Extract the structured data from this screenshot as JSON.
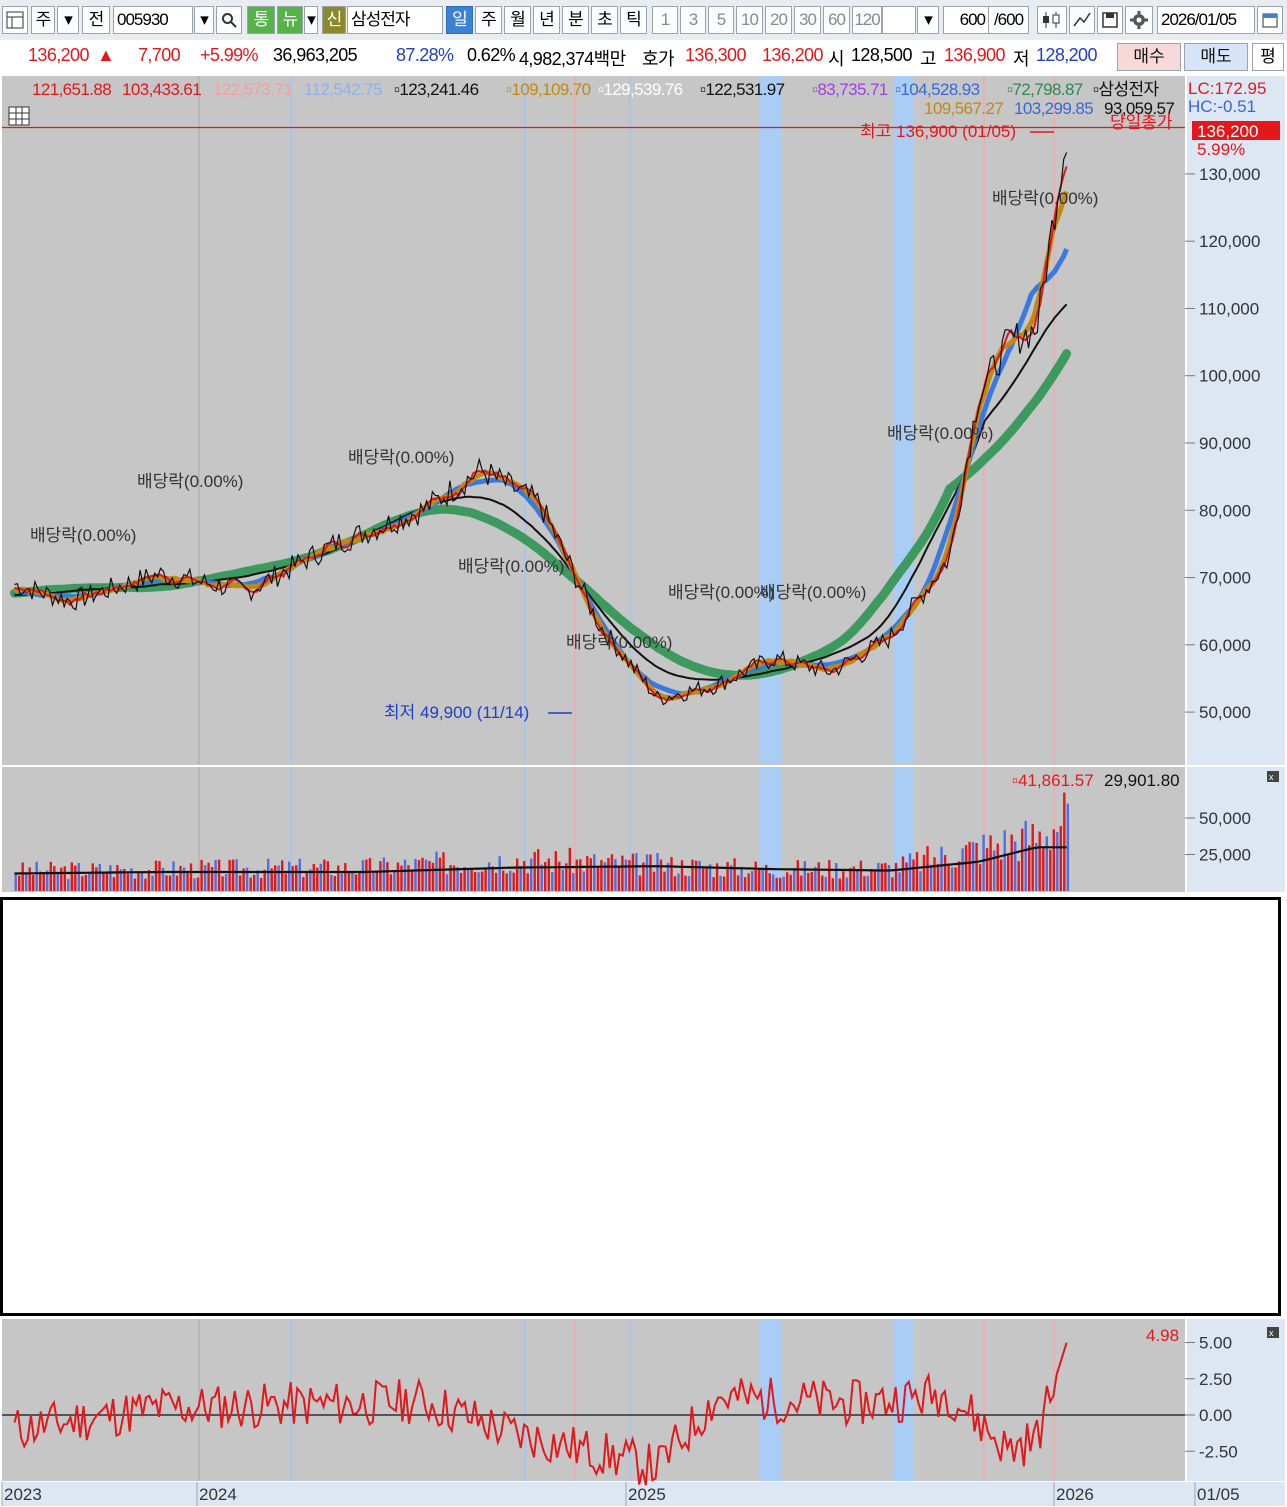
{
  "toolbar": {
    "market": "주",
    "prefix": "전",
    "code": "005930",
    "tong": "통",
    "nyu": "뉴",
    "sin": "신",
    "name": "삼성전자",
    "periods": [
      "일",
      "주",
      "월",
      "년",
      "분",
      "초",
      "틱"
    ],
    "active_period": "일",
    "intervals": [
      "1",
      "3",
      "5",
      "10",
      "20",
      "30",
      "60",
      "120"
    ],
    "count": "600",
    "count_total": "/600",
    "date": "2026/01/05"
  },
  "quote": {
    "price": "136,200",
    "arrow": "▲",
    "change": "7,700",
    "change_pct": "+5.99%",
    "volume": "36,963,205",
    "vol_ratio": "87.28%",
    "turnover": "0.62%",
    "trade_value": "4,982,374백만",
    "hoga_label": "호가",
    "ask": "136,300",
    "bid": "136,200",
    "open_label": "시",
    "open": "128,500",
    "high_label": "고",
    "high": "136,900",
    "low_label": "저",
    "low": "128,200",
    "buy_label": "매수",
    "sell_label": "매도",
    "flat_label": "평"
  },
  "legend_row1": [
    {
      "text": "121,651.88",
      "color": "#e0191d"
    },
    {
      "text": "103,433.61",
      "color": "#e0191d"
    },
    {
      "text": "122,573.71",
      "color": "#f0a0a0"
    },
    {
      "text": "112,542.75",
      "color": "#8fb2e6"
    },
    {
      "text": "▫123,241.46",
      "color": "#111111"
    },
    {
      "text": "▫109,109.70",
      "color": "#c08a10"
    },
    {
      "text": "▫129,539.76",
      "color": "#ffffff"
    },
    {
      "text": "▫122,531.97",
      "color": "#111111"
    },
    {
      "text": "▫83,735.71",
      "color": "#a040e0"
    },
    {
      "text": "▫104,528.93",
      "color": "#3a66d8"
    },
    {
      "text": "▫72,798.87",
      "color": "#2e8a52"
    },
    {
      "text": "▫삼성전자",
      "color": "#111111"
    }
  ],
  "legend_row2": [
    {
      "text": "109,567.27",
      "color": "#c08a10"
    },
    {
      "text": "103,299.85",
      "color": "#3a66d8"
    },
    {
      "text": "93,059.57",
      "color": "#111111"
    }
  ],
  "lc": "LC:172.95",
  "hc": "HC:-0.51",
  "today_total_label": "당일총가",
  "price_tag": "136,200",
  "price_tag_pct": "5.99%",
  "colors": {
    "up": "#e4171b",
    "down": "#3a66d8",
    "ma_black": "#111111",
    "ma_green": "#3c9a5f",
    "ma_gold": "#c08a10",
    "ma_blue": "#3a7ae0",
    "plot_bg": "#c6c6c6",
    "highlight_band": "#a9cdf4"
  },
  "chart_data": [
    {
      "type": "line",
      "title": "삼성전자",
      "ylim": [
        45000,
        142000
      ],
      "yticks": [
        "130,000",
        "120,000",
        "110,000",
        "100,000",
        "90,000",
        "80,000",
        "70,000",
        "60,000",
        "50,000"
      ],
      "x": [
        "2023-01",
        "2023-03",
        "2023-06",
        "2023-09",
        "2023-12",
        "2024-03",
        "2024-05",
        "2024-07",
        "2024-09",
        "2024-11",
        "2025-01",
        "2025-03",
        "2025-05",
        "2025-07",
        "2025-09",
        "2025-10",
        "2025-11",
        "2025-12",
        "2026-01"
      ],
      "series": [
        {
          "name": "삼성전자",
          "values": [
            69000,
            66500,
            70500,
            68000,
            75000,
            80000,
            86000,
            81000,
            63000,
            52000,
            54000,
            58000,
            56000,
            61000,
            73000,
            97000,
            105000,
            107000,
            136200
          ]
        }
      ],
      "x_labels": [
        "2023",
        "2024",
        "2025",
        "2026"
      ],
      "annotations": [
        {
          "text": "최고 136,900 (01/05)",
          "value": 136900
        },
        {
          "text": "최저 49,900 (11/14)",
          "value": 49900
        },
        {
          "text": "배당락(0.00%)"
        },
        {
          "text": "배당락(0.00%)"
        },
        {
          "text": "배당락(0.00%)"
        },
        {
          "text": "배당락(0.00%)"
        },
        {
          "text": "배당락(0.00%)"
        },
        {
          "text": "배당락(0.00%)"
        },
        {
          "text": "배당락(0.00%)"
        },
        {
          "text": "배당락(0.00%)"
        },
        {
          "text": "배당락(0.00%)"
        }
      ]
    },
    {
      "type": "bar",
      "title": "volume",
      "legend": [
        "▫41,861.57",
        "29,901.80"
      ],
      "ylim": [
        0,
        75000
      ],
      "yticks": [
        "50,000",
        "25,000"
      ],
      "x": [
        "2023-01",
        "2023-06",
        "2024-01",
        "2024-06",
        "2024-11",
        "2025-03",
        "2025-07",
        "2025-10",
        "2025-12",
        "2026-01"
      ],
      "values": [
        14000,
        15000,
        16000,
        22000,
        18000,
        15000,
        16000,
        30000,
        38000,
        52000
      ],
      "ma_values": [
        12000,
        13000,
        13000,
        16000,
        17000,
        15000,
        14000,
        20000,
        30000,
        29900
      ]
    },
    {
      "type": "line",
      "title": "oscillator",
      "ylim": [
        -4.2,
        6
      ],
      "yticks": [
        "5.00",
        "2.50",
        "0.00",
        "-2.50"
      ],
      "last_value": "4.98",
      "x": [
        "2023-01",
        "2023-06",
        "2024-01",
        "2024-03",
        "2024-06",
        "2024-11",
        "2025-01",
        "2025-06",
        "2025-09",
        "2025-11",
        "2025-12",
        "2026-01"
      ],
      "values": [
        -1.0,
        0.5,
        0.8,
        1.0,
        -1.2,
        -3.6,
        1.2,
        0.8,
        1.5,
        -2.4,
        -1.6,
        4.98
      ]
    }
  ],
  "x_axis_labels": [
    "2023",
    "2024",
    "2025",
    "2026",
    "01/05"
  ]
}
